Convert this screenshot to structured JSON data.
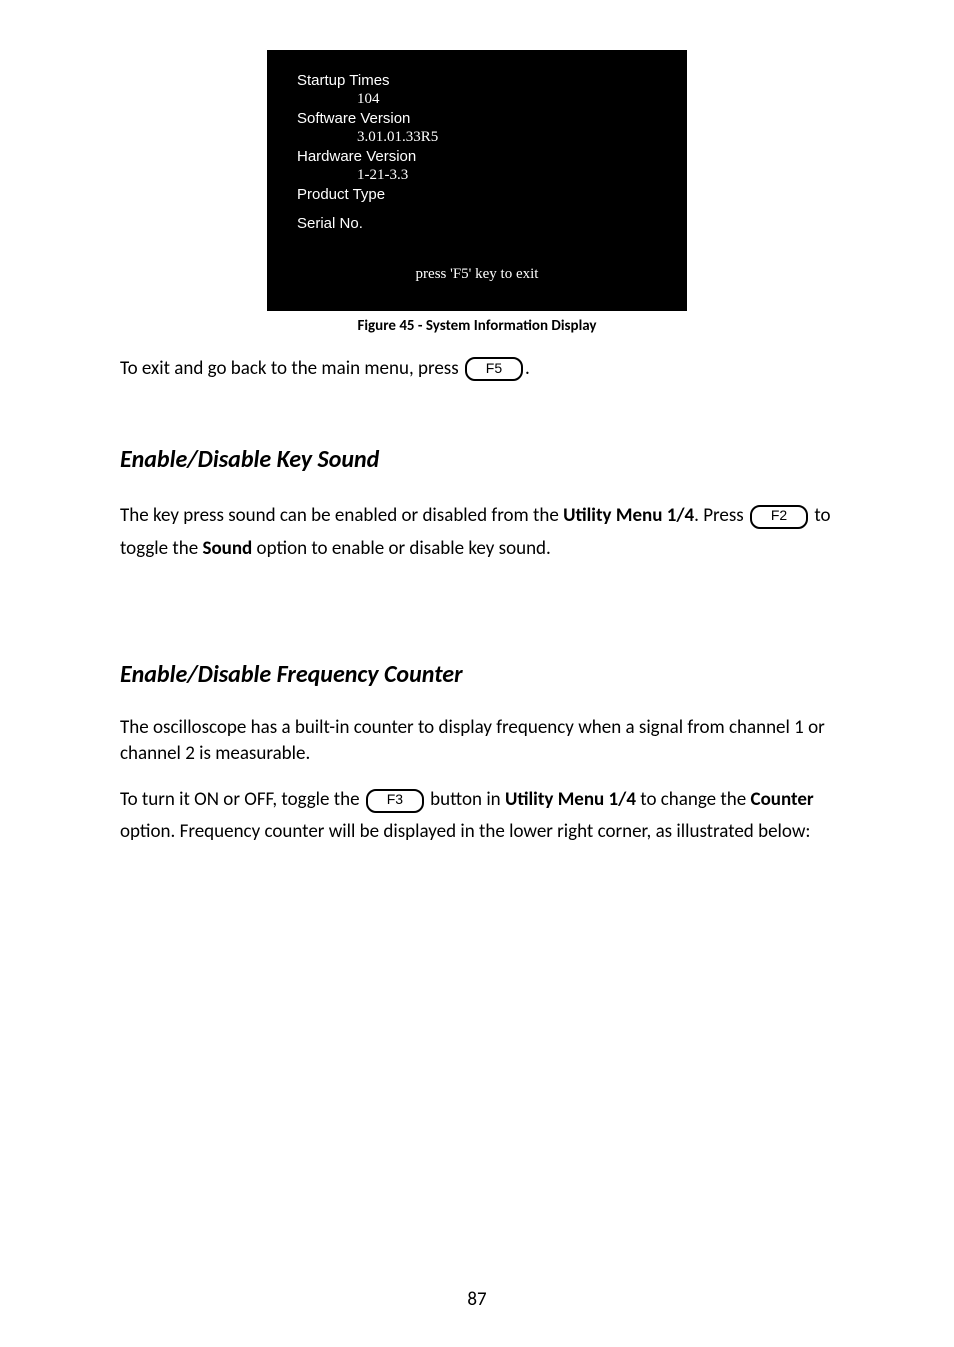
{
  "sysinfo": {
    "startup_times_label": "Startup Times",
    "startup_times_value": "104",
    "sw_version_label": "Software Version",
    "sw_version_value": "3.01.01.33R5",
    "hw_version_label": "Hardware Version",
    "hw_version_value": "1-21-3.3",
    "product_type_label": "Product Type",
    "serial_label": "Serial No.",
    "exit_text": "press 'F5' key to exit"
  },
  "figure_caption": "Figure 45 - System Information Display",
  "exit_line_pre": "To exit and go back to the main menu, press ",
  "exit_line_post": ".",
  "f5_key": "F5",
  "heading_keysound": "Enable/Disable Key Sound",
  "keysound_p1": "The key press sound can be enabled or disabled from the ",
  "utility_menu_label": "Utility Menu 1/4",
  "keysound_p2": ".  Press ",
  "f2_key": "F2",
  "keysound_p3": " to toggle the ",
  "sound_label": "Sound",
  "keysound_p4": " option to enable or disable key sound.",
  "heading_freqcounter": "Enable/Disable Frequency Counter",
  "freq_p1": "The oscilloscope has a built-in counter to display frequency when a signal from channel 1 or channel 2 is measurable.",
  "freq_p2_pre": "To turn it ON or OFF, toggle the ",
  "f3_key": "F3",
  "freq_p2_mid": " button in ",
  "freq_p2_post": " to change the ",
  "counter_label": "Counter",
  "freq_p2_end": " option.  Frequency counter will be displayed in the lower right corner, as illustrated below:",
  "page_number": "87"
}
